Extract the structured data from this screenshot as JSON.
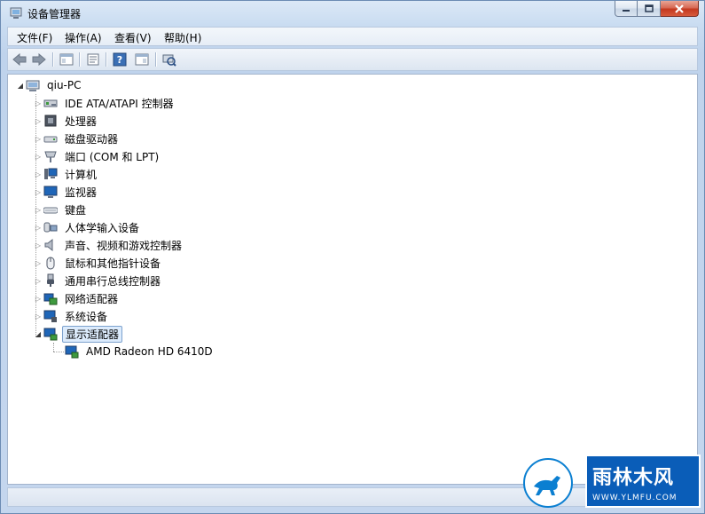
{
  "window": {
    "title": "设备管理器"
  },
  "menu": [
    "文件(F)",
    "操作(A)",
    "查看(V)",
    "帮助(H)"
  ],
  "toolbar": {
    "buttons": [
      "back-icon",
      "forward-icon",
      "show-hide-console-tree-icon",
      "properties-icon",
      "help-icon",
      "view-icon",
      "scan-hardware-icon"
    ]
  },
  "tree": {
    "root": "qiu-PC",
    "categories": [
      {
        "label": "IDE ATA/ATAPI 控制器",
        "icon": "ide-controller-icon"
      },
      {
        "label": "处理器",
        "icon": "processor-icon"
      },
      {
        "label": "磁盘驱动器",
        "icon": "disk-drive-icon"
      },
      {
        "label": "端口 (COM 和 LPT)",
        "icon": "port-icon"
      },
      {
        "label": "计算机",
        "icon": "computer-icon"
      },
      {
        "label": "监视器",
        "icon": "monitor-icon"
      },
      {
        "label": "键盘",
        "icon": "keyboard-icon"
      },
      {
        "label": "人体学输入设备",
        "icon": "hid-icon"
      },
      {
        "label": "声音、视频和游戏控制器",
        "icon": "sound-icon"
      },
      {
        "label": "鼠标和其他指针设备",
        "icon": "mouse-icon"
      },
      {
        "label": "通用串行总线控制器",
        "icon": "usb-icon"
      },
      {
        "label": "网络适配器",
        "icon": "network-adapter-icon"
      },
      {
        "label": "系统设备",
        "icon": "system-device-icon"
      },
      {
        "label": "显示适配器",
        "icon": "display-adapter-icon",
        "expanded": true,
        "selected": true
      }
    ],
    "child": "AMD Radeon HD 6410D"
  },
  "watermark": {
    "text": "雨林木风",
    "url": "WWW.YLMFU.COM"
  }
}
